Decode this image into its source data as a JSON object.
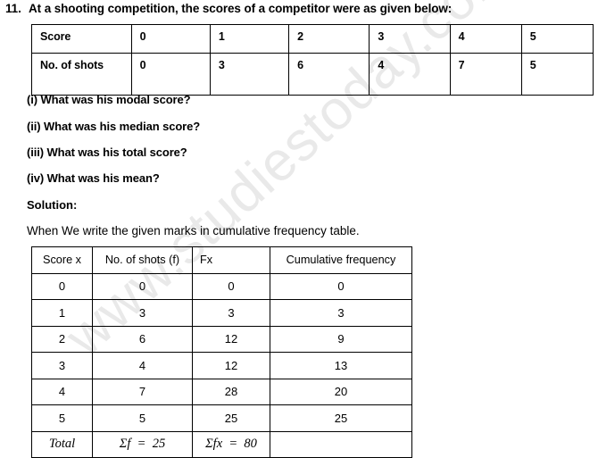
{
  "watermark": {
    "text": "www.studiestoday.com",
    "color": "#e9e9e9"
  },
  "question": {
    "number": "11.",
    "text": "At a shooting competition, the scores of a competitor were as given below:"
  },
  "scores_table": {
    "rows": [
      {
        "label": "Score",
        "values": [
          "0",
          "1",
          "2",
          "3",
          "4",
          "5"
        ]
      },
      {
        "label": "No. of shots",
        "values": [
          "0",
          "3",
          "6",
          "4",
          "7",
          "5"
        ]
      }
    ]
  },
  "subquestions": [
    "(i) What was his modal score?",
    "(ii) What was his median score?",
    "(iii) What was his total score?",
    "(iv) What was his mean?"
  ],
  "solution": {
    "label": "Solution:",
    "intro": "When We write the given marks in cumulative frequency table."
  },
  "cumulative_table": {
    "headers": [
      "Score x",
      "No. of shots (f)",
      "Fx",
      "Cumulative frequency"
    ],
    "rows": [
      [
        "0",
        "0",
        "0",
        "0"
      ],
      [
        "1",
        "3",
        "3",
        "3"
      ],
      [
        "2",
        "6",
        "12",
        "9"
      ],
      [
        "3",
        "4",
        "12",
        "13"
      ],
      [
        "4",
        "7",
        "28",
        "20"
      ],
      [
        "5",
        "5",
        "25",
        "25"
      ]
    ],
    "total_row": {
      "label": "Total",
      "sum_f": "Σf  =  25",
      "sum_fx": "Σfx  =  80",
      "cumulative": ""
    }
  },
  "chart_data": {
    "type": "table",
    "title": "Cumulative frequency table for shooting scores",
    "categories": [
      "0",
      "1",
      "2",
      "3",
      "4",
      "5"
    ],
    "series": [
      {
        "name": "No. of shots (f)",
        "values": [
          0,
          3,
          6,
          4,
          7,
          5
        ]
      },
      {
        "name": "Fx",
        "values": [
          0,
          3,
          12,
          12,
          28,
          25
        ]
      },
      {
        "name": "Cumulative frequency",
        "values": [
          0,
          3,
          9,
          13,
          20,
          25
        ]
      }
    ],
    "totals": {
      "sum_f": 25,
      "sum_fx": 80
    },
    "xlabel": "Score x",
    "ylabel": ""
  }
}
